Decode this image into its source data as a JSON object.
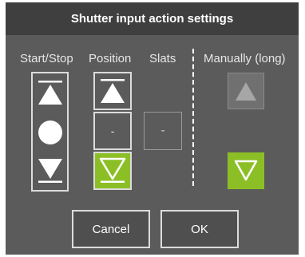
{
  "dialog": {
    "title": "Shutter input action settings"
  },
  "columns": {
    "start_stop": "Start/Stop",
    "position": "Position",
    "slats": "Slats",
    "manually": "Manually (long)"
  },
  "buttons": {
    "position_middle": "-",
    "slats": "-",
    "cancel": "Cancel",
    "ok": "OK"
  },
  "state": {
    "position_selected": "down",
    "manually_selected": "down"
  },
  "icons": {
    "start_stop_up": "triangle-up-bar-icon",
    "start_stop_stop": "circle-stop-icon",
    "start_stop_down": "triangle-down-bar-icon",
    "position_up": "triangle-up-bar-icon",
    "position_down": "triangle-down-bar-icon",
    "manual_up": "triangle-up-icon",
    "manual_down": "triangle-down-icon"
  },
  "colors": {
    "title_bar": "#3f3f3f",
    "dialog_bg": "#5b5b5b",
    "accent_selected": "#8cbf26",
    "manual_up_bg": "#707070",
    "manual_up_icon": "#a6a6a6"
  }
}
